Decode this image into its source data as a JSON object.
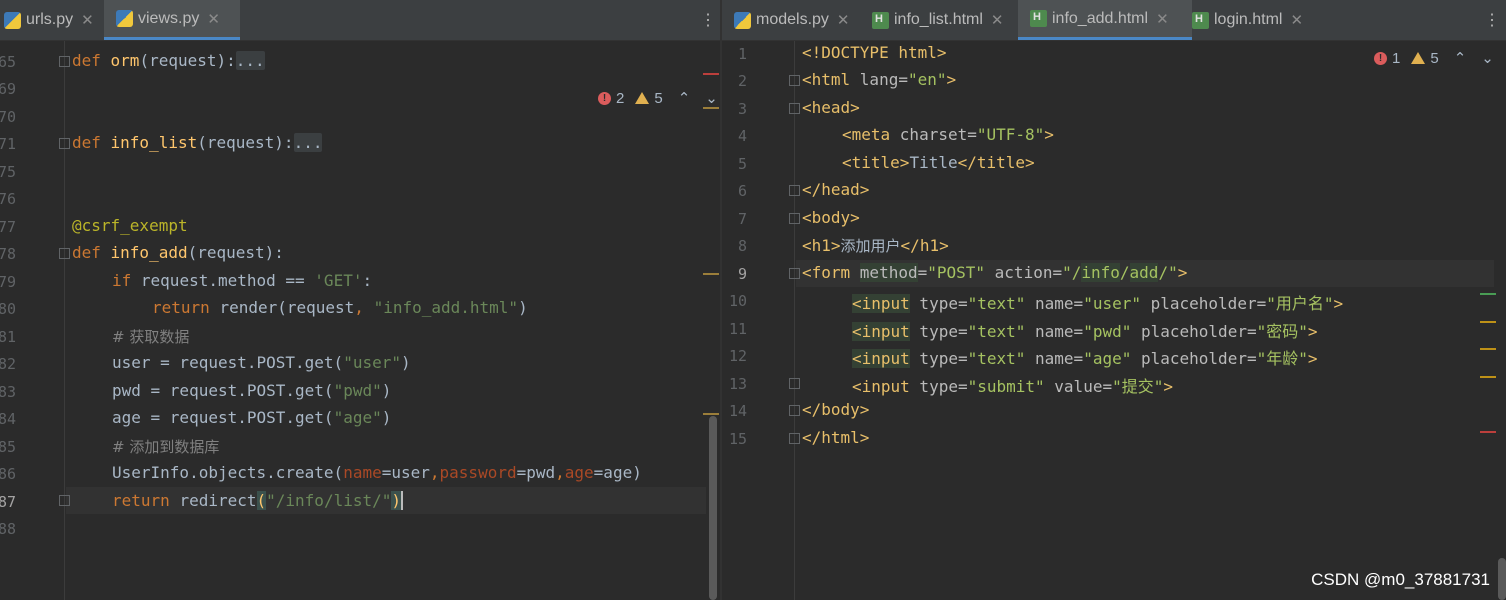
{
  "left_tabs": [
    {
      "label": "urls.py",
      "icon": "python-file-icon",
      "active": false
    },
    {
      "label": "views.py",
      "icon": "python-file-icon",
      "active": true
    }
  ],
  "right_tabs": [
    {
      "label": "models.py",
      "icon": "python-file-icon",
      "active": false
    },
    {
      "label": "info_list.html",
      "icon": "html-file-icon",
      "active": false
    },
    {
      "label": "info_add.html",
      "icon": "html-file-icon",
      "active": true
    },
    {
      "label": "login.html",
      "icon": "html-file-icon",
      "active": false
    }
  ],
  "left_inspect": {
    "errors": "2",
    "warnings": "5"
  },
  "right_inspect": {
    "errors": "1",
    "warnings": "5"
  },
  "left_line_numbers": [
    "65",
    "69",
    "70",
    "71",
    "75",
    "76",
    "77",
    "78",
    "79",
    "80",
    "81",
    "82",
    "83",
    "84",
    "85",
    "86",
    "87",
    "88"
  ],
  "right_line_numbers": [
    "1",
    "2",
    "3",
    "4",
    "5",
    "6",
    "7",
    "8",
    "9",
    "10",
    "11",
    "12",
    "13",
    "14",
    "15"
  ],
  "left_code": {
    "l65_def": "def ",
    "l65_name": "orm",
    "l65_args": "(request):",
    "l65_fold": "...",
    "l71_def": "def ",
    "l71_name": "info_list",
    "l71_args": "(request):",
    "l71_fold": "...",
    "l77": "@csrf_exempt",
    "l78_def": "def ",
    "l78_name": "info_add",
    "l78_args": "(request):",
    "l79_kw": "if ",
    "l79_mid": "request.method == ",
    "l79_str": "'GET'",
    "l79_end": ":",
    "l80_kw": "return ",
    "l80_mid": "render(request",
    "l80_comma": ", ",
    "l80_str": "\"info_add.html\"",
    "l80_end": ")",
    "l81": "# 获取数据",
    "l82_a": "user = request.POST.get(",
    "l82_s": "\"user\"",
    "l82_b": ")",
    "l83_a": "pwd = request.POST.get(",
    "l83_s": "\"pwd\"",
    "l83_b": ")",
    "l84_a": "age = request.POST.get(",
    "l84_s": "\"age\"",
    "l84_b": ")",
    "l85": "# 添加到数据库",
    "l86_a": "UserInfo.objects.create(",
    "l86_p1": "name",
    "l86_v1": "=user",
    "l86_c1": ",",
    "l86_p2": "password",
    "l86_v2": "=pwd",
    "l86_c2": ",",
    "l86_p3": "age",
    "l86_v3": "=age)",
    "l87_kw": "return ",
    "l87_a": "redirect",
    "l87_p1": "(",
    "l87_s": "\"/info/list/\"",
    "l87_p2": ")"
  },
  "right_code": {
    "r1": "<!DOCTYPE html>",
    "r2_a": "<html ",
    "r2_b": "lang=",
    "r2_c": "\"en\"",
    "r2_d": ">",
    "r3": "<head>",
    "r4_a": "<meta ",
    "r4_b": "charset=",
    "r4_c": "\"UTF-8\"",
    "r4_d": ">",
    "r5_a": "<title>",
    "r5_b": "Title",
    "r5_c": "</title>",
    "r6": "</head>",
    "r7": "<body>",
    "r8_a": "<h1>",
    "r8_b": "添加用户",
    "r8_c": "</h1>",
    "r9_a": "<form ",
    "r9_b": "method",
    "r9_c": "=",
    "r9_d": "\"POST\"",
    "r9_e": " action=",
    "r9_f": "\"/",
    "r9_g": "info",
    "r9_h": "/",
    "r9_i": "add",
    "r9_j": "/\"",
    "r9_k": ">",
    "input_tag": "<input",
    "r10_attrs1": " type=",
    "r10_v1": "\"text\"",
    "r10_attrs2": " name=",
    "r10_v2": "\"user\"",
    "r10_attrs3": " placeholder=",
    "r10_v3": "\"用户名\"",
    "r10_end": ">",
    "r11_v2": "\"pwd\"",
    "r11_v3": "\"密码\"",
    "r12_v2": "\"age\"",
    "r12_v3": "\"年龄\"",
    "r13_v1": "\"submit\"",
    "r13_attrs2": " value=",
    "r13_v2": "\"提交\"",
    "r14": "</body>",
    "r15": "</html>"
  },
  "watermark": "CSDN @m0_37881731",
  "colors": {
    "error": "#db5c5c",
    "warning": "#e0b050",
    "accent": "#4a88c7"
  }
}
